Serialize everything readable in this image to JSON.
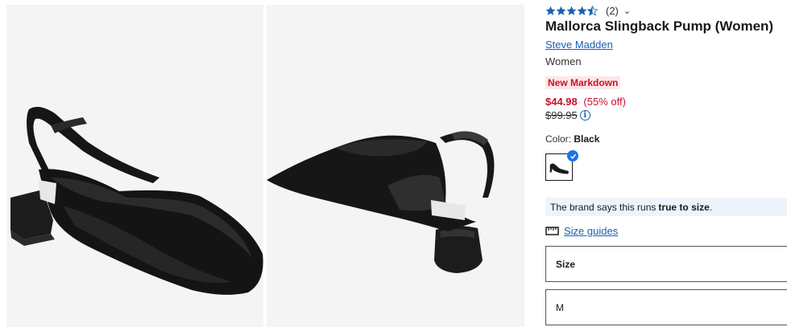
{
  "gallery": {
    "images": [
      {
        "name": "shoe-front-angle"
      },
      {
        "name": "shoe-back-angle"
      }
    ]
  },
  "product": {
    "rating_value": 4.5,
    "rating_count": "(2)",
    "title": "Mallorca Slingback Pump (Women)",
    "brand": "Steve Madden",
    "gender": "Women",
    "badge": "New Markdown",
    "price": "$44.98",
    "discount": "(55% off)",
    "original_price": "$99.95",
    "info_icon": "i",
    "color_label": "Color:",
    "color_value": "Black",
    "fit_text_prefix": "The brand says this runs",
    "fit_text_bold": "true to size",
    "fit_text_suffix": ".",
    "size_guides_label": "Size guides",
    "size_label": "Size",
    "width_value": "M"
  },
  "colors": {
    "star": "#1a5fb4",
    "price": "#c8102e",
    "link": "#1a5fb4",
    "badge_bg": "#fde8e6",
    "fit_bg": "#eef4fb",
    "check": "#1a73e8"
  },
  "icons": {
    "chevron": "chevron-down-icon",
    "info": "info-icon",
    "ruler": "size-guide-icon",
    "check": "check-icon"
  }
}
